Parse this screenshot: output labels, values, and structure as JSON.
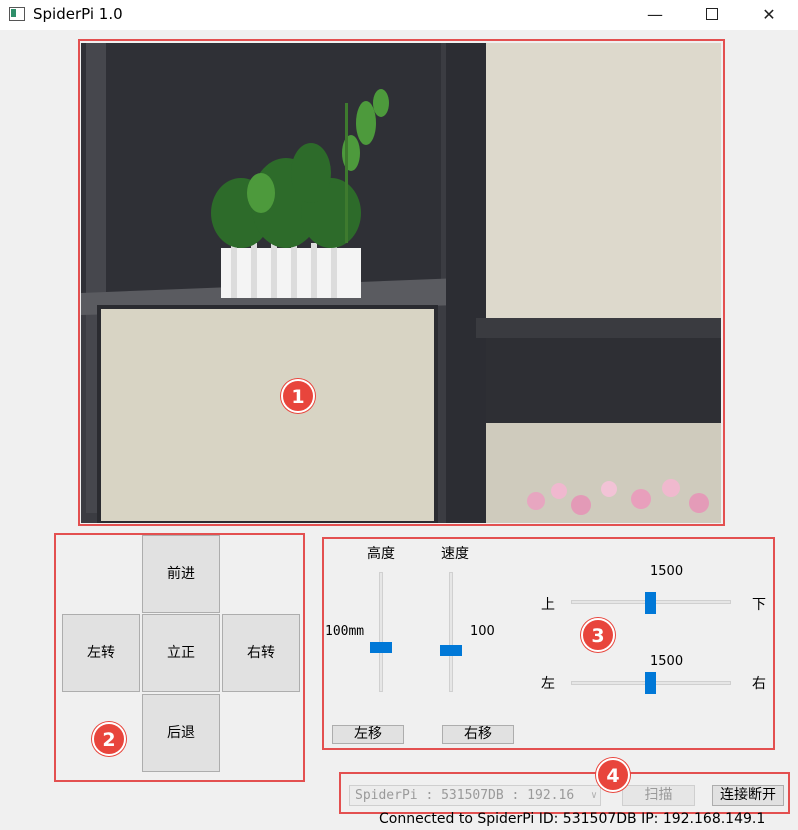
{
  "window": {
    "title": "SpiderPi 1.0",
    "minimize_glyph": "—",
    "close_glyph": "✕",
    "icons": [
      "app-icon",
      "minimize-icon",
      "maximize-icon",
      "close-icon"
    ]
  },
  "annotations": {
    "camera_badge": "1",
    "movement_badge": "2",
    "sliders_badge": "3",
    "connection_badge": "4",
    "color": "#e8453c"
  },
  "movement": {
    "forward": "前进",
    "turn_left": "左转",
    "stand": "立正",
    "turn_right": "右转",
    "backward": "后退"
  },
  "posture": {
    "height_label": "高度",
    "speed_label": "速度",
    "height_value": "100mm",
    "speed_value": "100",
    "height_slider_fraction": 0.62,
    "speed_slider_fraction": 0.62,
    "shift_left": "左移",
    "shift_right": "右移"
  },
  "camera_servo": {
    "vertical_value": "1500",
    "vertical_min_label": "上",
    "vertical_max_label": "下",
    "horizontal_value": "1500",
    "horizontal_min_label": "左",
    "horizontal_max_label": "右",
    "vertical_fraction": 0.5,
    "horizontal_fraction": 0.5
  },
  "connection": {
    "device_selected": "SpiderPi : 531507DB : 192.16",
    "scan_button": "扫描",
    "connect_button": "连接断开",
    "status": "Connected to SpiderPi  ID: 531507DB  IP: 192.168.149.1"
  },
  "colors": {
    "accent": "#0078d7",
    "annotation": "#e35050"
  }
}
